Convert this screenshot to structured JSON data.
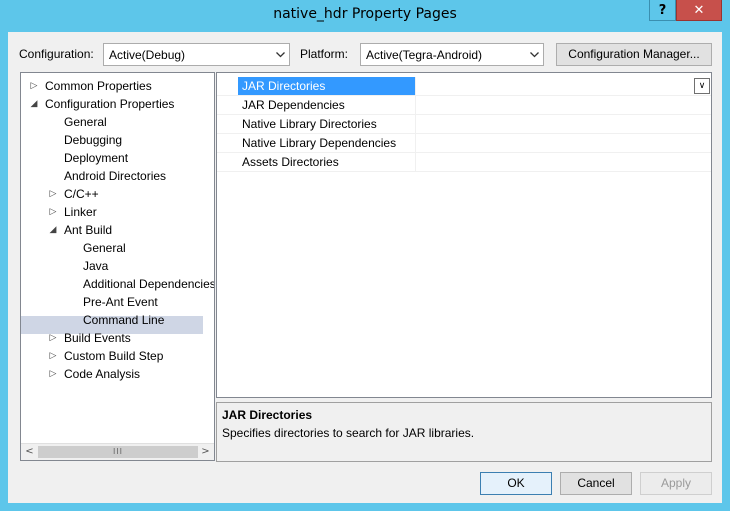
{
  "window": {
    "title": "native_hdr Property Pages",
    "help_label": "?",
    "close_label": "✕"
  },
  "config": {
    "configuration_label": "Configuration:",
    "configuration_value": "Active(Debug)",
    "platform_label": "Platform:",
    "platform_value": "Active(Tegra-Android)",
    "manager_button": "Configuration Manager..."
  },
  "tree": {
    "items": [
      {
        "label": "Common Properties",
        "expander": "▷"
      },
      {
        "label": "Configuration Properties",
        "expander": "◢"
      },
      {
        "label": "General"
      },
      {
        "label": "Debugging"
      },
      {
        "label": "Deployment"
      },
      {
        "label": "Android Directories"
      },
      {
        "label": "C/C++",
        "expander": "▷"
      },
      {
        "label": "Linker",
        "expander": "▷"
      },
      {
        "label": "Ant Build",
        "expander": "◢"
      },
      {
        "label": "General"
      },
      {
        "label": "Java"
      },
      {
        "label": "Additional Dependencies"
      },
      {
        "label": "Pre-Ant Event"
      },
      {
        "label": "Command Line"
      },
      {
        "label": "Build Events",
        "expander": "▷"
      },
      {
        "label": "Custom Build Step",
        "expander": "▷"
      },
      {
        "label": "Code Analysis",
        "expander": "▷"
      }
    ],
    "scroll_left": "<",
    "scroll_right": ">",
    "scroll_grip": "III"
  },
  "grid": {
    "rows": [
      {
        "name": "JAR Directories",
        "value": ""
      },
      {
        "name": "JAR Dependencies",
        "value": ""
      },
      {
        "name": "Native Library Directories",
        "value": ""
      },
      {
        "name": "Native Library Dependencies",
        "value": ""
      },
      {
        "name": "Assets Directories",
        "value": ""
      }
    ],
    "dropdown_glyph": "∨"
  },
  "description": {
    "title": "JAR Directories",
    "text": "Specifies directories to search for JAR libraries."
  },
  "buttons": {
    "ok": "OK",
    "cancel": "Cancel",
    "apply": "Apply"
  }
}
